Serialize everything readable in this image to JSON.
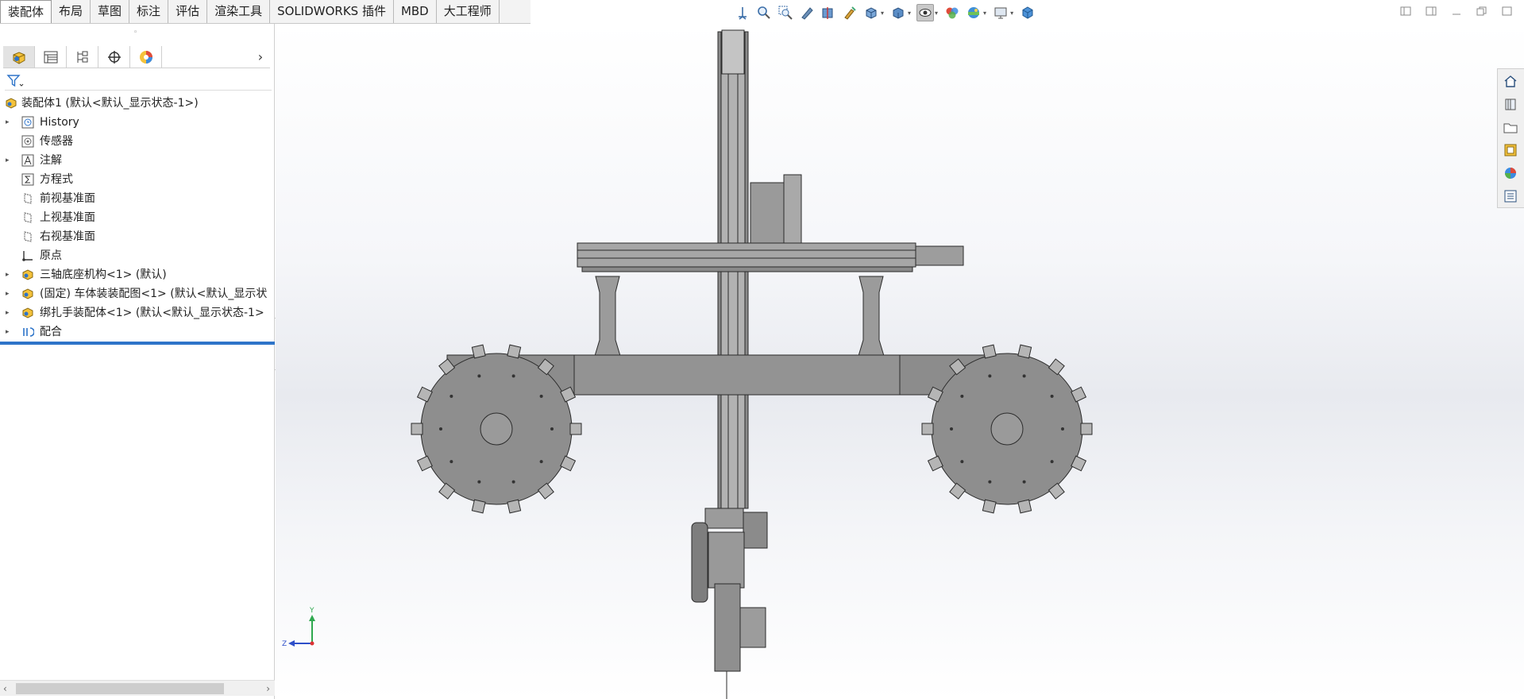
{
  "command_tabs": [
    "装配体",
    "布局",
    "草图",
    "标注",
    "评估",
    "渲染工具",
    "SOLIDWORKS 插件",
    "MBD",
    "大工程师"
  ],
  "active_tab": "装配体",
  "hud_toolbar": {
    "icons": [
      "view-orientation-icon",
      "zoom-to-fit-icon",
      "zoom-to-area-icon",
      "previous-view-icon",
      "section-view-icon",
      "dynamic-annotation-icon",
      "view-orientation-dropdown-icon",
      "display-style-icon",
      "hide-show-items-icon",
      "edit-appearance-icon",
      "apply-scene-icon",
      "view-settings-icon",
      "3d-view-icon"
    ]
  },
  "window_controls": [
    "tile-left-icon",
    "tile-right-icon",
    "restore-icon",
    "minimize-icon",
    "maximize-icon"
  ],
  "feature_manager": {
    "tabs": [
      "feature-manager-tab",
      "property-manager-tab",
      "configuration-manager-tab",
      "dimxpert-manager-tab",
      "display-manager-tab"
    ],
    "filter_icon": "filter-icon",
    "tree": [
      {
        "label": "装配体1 (默认<默认_显示状态-1>)",
        "icon": "assembly-icon",
        "arrow": false,
        "indent": 0
      },
      {
        "label": "History",
        "icon": "history-icon",
        "arrow": true,
        "indent": 1
      },
      {
        "label": "传感器",
        "icon": "sensor-icon",
        "arrow": false,
        "indent": 1
      },
      {
        "label": "注解",
        "icon": "annotation-icon",
        "arrow": true,
        "indent": 1
      },
      {
        "label": "方程式",
        "icon": "equation-icon",
        "arrow": false,
        "indent": 1
      },
      {
        "label": "前视基准面",
        "icon": "plane-icon",
        "arrow": false,
        "indent": 1
      },
      {
        "label": "上视基准面",
        "icon": "plane-icon",
        "arrow": false,
        "indent": 1
      },
      {
        "label": "右视基准面",
        "icon": "plane-icon",
        "arrow": false,
        "indent": 1
      },
      {
        "label": "原点",
        "icon": "origin-icon",
        "arrow": false,
        "indent": 1
      },
      {
        "label": "三轴底座机构<1> (默认)",
        "icon": "subassembly-icon",
        "arrow": true,
        "indent": 1
      },
      {
        "label": "(固定) 车体装装配图<1> (默认<默认_显示状",
        "icon": "subassembly-icon",
        "arrow": true,
        "indent": 1
      },
      {
        "label": "绑扎手装配体<1> (默认<默认_显示状态-1>",
        "icon": "subassembly-icon",
        "arrow": true,
        "indent": 1
      },
      {
        "label": "配合",
        "icon": "mates-icon",
        "arrow": true,
        "indent": 1
      }
    ]
  },
  "task_pane": [
    "home-icon",
    "design-library-icon",
    "file-explorer-icon",
    "view-palette-icon",
    "appearances-icon",
    "custom-properties-icon"
  ],
  "triad": {
    "y_label": "Y",
    "z_label": "Z"
  },
  "colors": {
    "model_gray": "#8e8e8e",
    "model_edge": "#2b2b2b",
    "accent_blue": "#2e74c9"
  }
}
